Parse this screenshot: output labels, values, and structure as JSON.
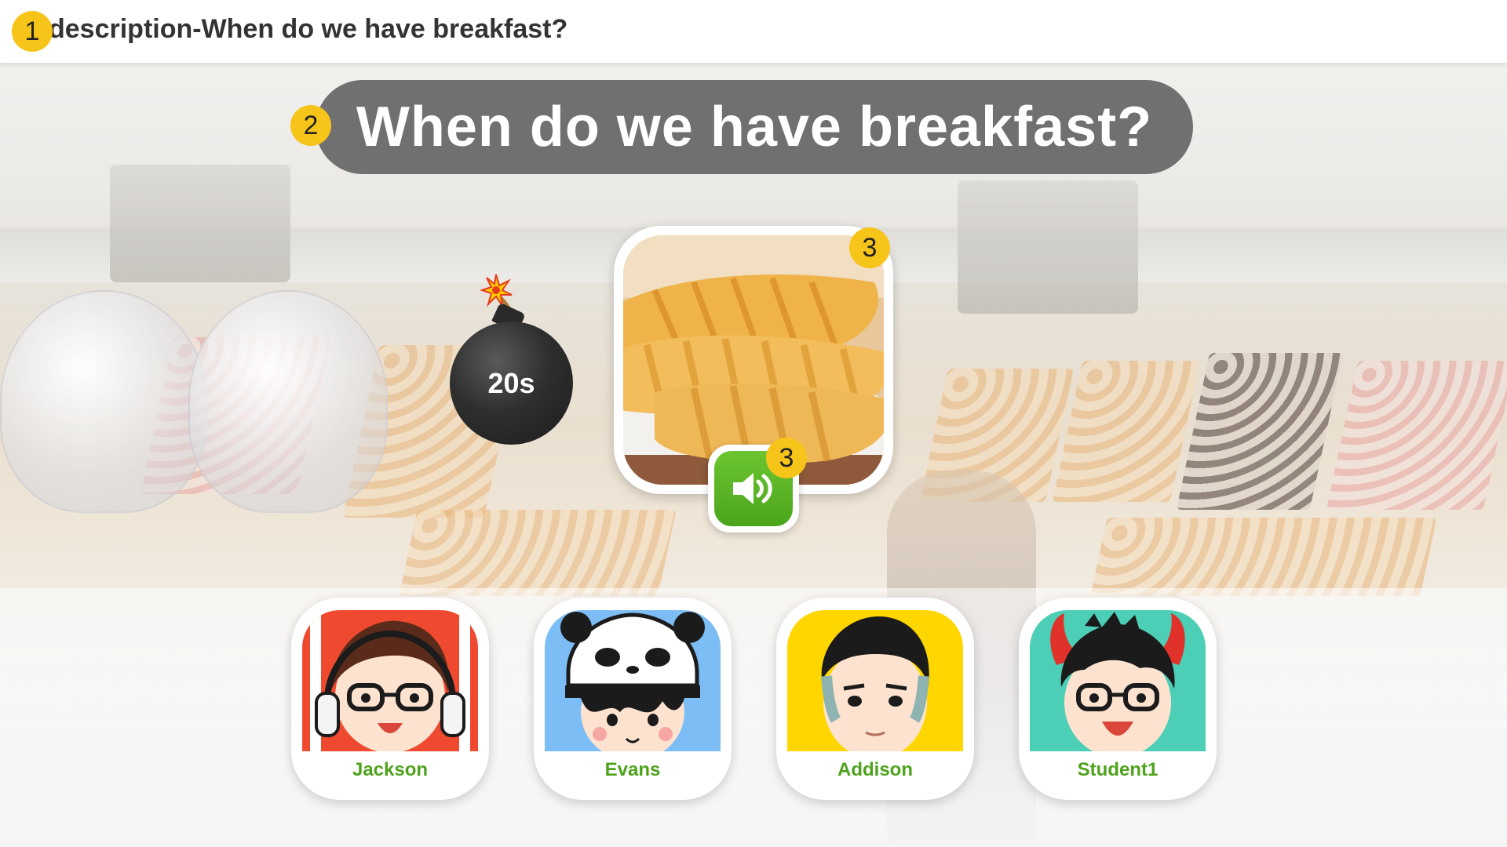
{
  "header": {
    "title": "description-When do we have breakfast?"
  },
  "markers": {
    "m1": "1",
    "m2": "2",
    "m3a": "3",
    "m3b": "3"
  },
  "question": {
    "text": "When do we have breakfast?"
  },
  "timer": {
    "label": "20s",
    "icon": "bomb-icon"
  },
  "food": {
    "icon": "bread-image"
  },
  "audio": {
    "icon": "speaker-icon"
  },
  "students": [
    {
      "name": "Jackson",
      "bg": "#ef4a2f"
    },
    {
      "name": "Evans",
      "bg": "#7dbdf5"
    },
    {
      "name": "Addison",
      "bg": "#ffd600"
    },
    {
      "name": "Student1",
      "bg": "#4ccfb6"
    }
  ],
  "colors": {
    "accent_green": "#4ea21c",
    "marker_yellow": "#f7c41a",
    "banner": "#5f5f5f"
  }
}
